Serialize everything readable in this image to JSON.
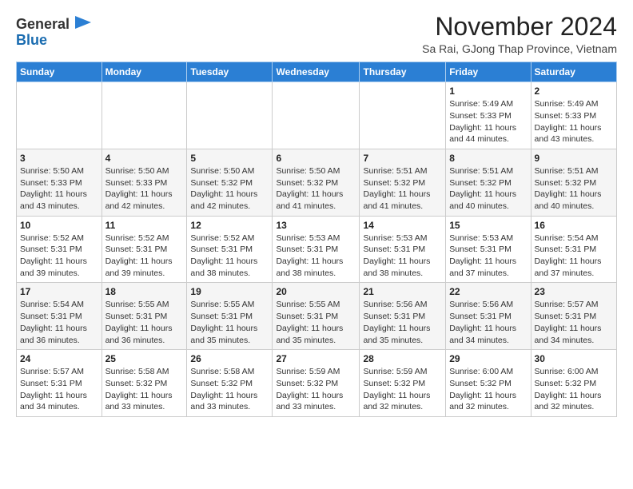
{
  "logo": {
    "general": "General",
    "blue": "Blue"
  },
  "title": "November 2024",
  "subtitle": "Sa Rai, GJong Thap Province, Vietnam",
  "headers": [
    "Sunday",
    "Monday",
    "Tuesday",
    "Wednesday",
    "Thursday",
    "Friday",
    "Saturday"
  ],
  "weeks": [
    [
      {
        "day": "",
        "info": ""
      },
      {
        "day": "",
        "info": ""
      },
      {
        "day": "",
        "info": ""
      },
      {
        "day": "",
        "info": ""
      },
      {
        "day": "",
        "info": ""
      },
      {
        "day": "1",
        "info": "Sunrise: 5:49 AM\nSunset: 5:33 PM\nDaylight: 11 hours\nand 44 minutes."
      },
      {
        "day": "2",
        "info": "Sunrise: 5:49 AM\nSunset: 5:33 PM\nDaylight: 11 hours\nand 43 minutes."
      }
    ],
    [
      {
        "day": "3",
        "info": "Sunrise: 5:50 AM\nSunset: 5:33 PM\nDaylight: 11 hours\nand 43 minutes."
      },
      {
        "day": "4",
        "info": "Sunrise: 5:50 AM\nSunset: 5:33 PM\nDaylight: 11 hours\nand 42 minutes."
      },
      {
        "day": "5",
        "info": "Sunrise: 5:50 AM\nSunset: 5:32 PM\nDaylight: 11 hours\nand 42 minutes."
      },
      {
        "day": "6",
        "info": "Sunrise: 5:50 AM\nSunset: 5:32 PM\nDaylight: 11 hours\nand 41 minutes."
      },
      {
        "day": "7",
        "info": "Sunrise: 5:51 AM\nSunset: 5:32 PM\nDaylight: 11 hours\nand 41 minutes."
      },
      {
        "day": "8",
        "info": "Sunrise: 5:51 AM\nSunset: 5:32 PM\nDaylight: 11 hours\nand 40 minutes."
      },
      {
        "day": "9",
        "info": "Sunrise: 5:51 AM\nSunset: 5:32 PM\nDaylight: 11 hours\nand 40 minutes."
      }
    ],
    [
      {
        "day": "10",
        "info": "Sunrise: 5:52 AM\nSunset: 5:31 PM\nDaylight: 11 hours\nand 39 minutes."
      },
      {
        "day": "11",
        "info": "Sunrise: 5:52 AM\nSunset: 5:31 PM\nDaylight: 11 hours\nand 39 minutes."
      },
      {
        "day": "12",
        "info": "Sunrise: 5:52 AM\nSunset: 5:31 PM\nDaylight: 11 hours\nand 38 minutes."
      },
      {
        "day": "13",
        "info": "Sunrise: 5:53 AM\nSunset: 5:31 PM\nDaylight: 11 hours\nand 38 minutes."
      },
      {
        "day": "14",
        "info": "Sunrise: 5:53 AM\nSunset: 5:31 PM\nDaylight: 11 hours\nand 38 minutes."
      },
      {
        "day": "15",
        "info": "Sunrise: 5:53 AM\nSunset: 5:31 PM\nDaylight: 11 hours\nand 37 minutes."
      },
      {
        "day": "16",
        "info": "Sunrise: 5:54 AM\nSunset: 5:31 PM\nDaylight: 11 hours\nand 37 minutes."
      }
    ],
    [
      {
        "day": "17",
        "info": "Sunrise: 5:54 AM\nSunset: 5:31 PM\nDaylight: 11 hours\nand 36 minutes."
      },
      {
        "day": "18",
        "info": "Sunrise: 5:55 AM\nSunset: 5:31 PM\nDaylight: 11 hours\nand 36 minutes."
      },
      {
        "day": "19",
        "info": "Sunrise: 5:55 AM\nSunset: 5:31 PM\nDaylight: 11 hours\nand 35 minutes."
      },
      {
        "day": "20",
        "info": "Sunrise: 5:55 AM\nSunset: 5:31 PM\nDaylight: 11 hours\nand 35 minutes."
      },
      {
        "day": "21",
        "info": "Sunrise: 5:56 AM\nSunset: 5:31 PM\nDaylight: 11 hours\nand 35 minutes."
      },
      {
        "day": "22",
        "info": "Sunrise: 5:56 AM\nSunset: 5:31 PM\nDaylight: 11 hours\nand 34 minutes."
      },
      {
        "day": "23",
        "info": "Sunrise: 5:57 AM\nSunset: 5:31 PM\nDaylight: 11 hours\nand 34 minutes."
      }
    ],
    [
      {
        "day": "24",
        "info": "Sunrise: 5:57 AM\nSunset: 5:31 PM\nDaylight: 11 hours\nand 34 minutes."
      },
      {
        "day": "25",
        "info": "Sunrise: 5:58 AM\nSunset: 5:32 PM\nDaylight: 11 hours\nand 33 minutes."
      },
      {
        "day": "26",
        "info": "Sunrise: 5:58 AM\nSunset: 5:32 PM\nDaylight: 11 hours\nand 33 minutes."
      },
      {
        "day": "27",
        "info": "Sunrise: 5:59 AM\nSunset: 5:32 PM\nDaylight: 11 hours\nand 33 minutes."
      },
      {
        "day": "28",
        "info": "Sunrise: 5:59 AM\nSunset: 5:32 PM\nDaylight: 11 hours\nand 32 minutes."
      },
      {
        "day": "29",
        "info": "Sunrise: 6:00 AM\nSunset: 5:32 PM\nDaylight: 11 hours\nand 32 minutes."
      },
      {
        "day": "30",
        "info": "Sunrise: 6:00 AM\nSunset: 5:32 PM\nDaylight: 11 hours\nand 32 minutes."
      }
    ]
  ]
}
